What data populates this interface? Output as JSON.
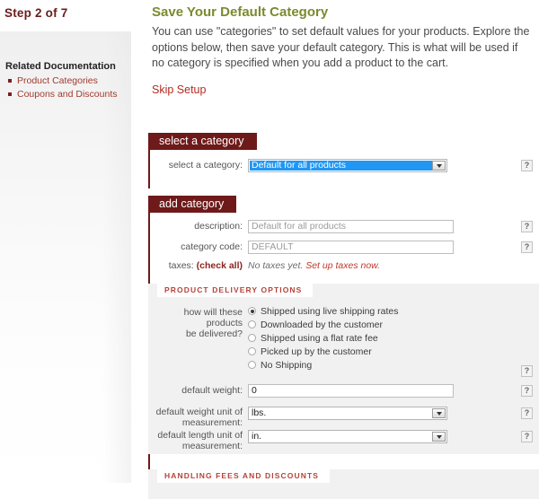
{
  "sidebar": {
    "step_label": "Step 2 of 7",
    "related_title": "Related Documentation",
    "links": [
      {
        "label": "Product Categories"
      },
      {
        "label": "Coupons and Discounts"
      }
    ]
  },
  "main": {
    "title": "Save Your Default Category",
    "intro": "You can use \"categories\" to set default values for your products. Explore the options below, then save your default category. This is what will be used if no category is specified when you add a product to the cart.",
    "skip_link": "Skip Setup"
  },
  "select_category_section": {
    "heading": "select a category",
    "row": {
      "label": "select a category:",
      "value": "Default for all products",
      "help": "?"
    }
  },
  "add_category_section": {
    "heading": "add category",
    "description_row": {
      "label": "description:",
      "value": "Default for all products",
      "help": "?"
    },
    "category_code_row": {
      "label": "category code:",
      "value": "DEFAULT",
      "help": "?"
    },
    "taxes_row": {
      "label": "taxes:",
      "check_all": "(check all)",
      "note": "No taxes yet.",
      "action": "Set up taxes now."
    }
  },
  "delivery_panel": {
    "heading": "PRODUCT DELIVERY OPTIONS",
    "question_label_line1": "how will these products",
    "question_label_line2": "be delivered?",
    "options": [
      {
        "label": "Shipped using live shipping rates",
        "selected": true
      },
      {
        "label": "Downloaded by the customer",
        "selected": false
      },
      {
        "label": "Shipped using a flat rate fee",
        "selected": false
      },
      {
        "label": "Picked up by the customer",
        "selected": false
      },
      {
        "label": "No Shipping",
        "selected": false
      }
    ],
    "delivery_help": "?",
    "default_weight_row": {
      "label": "default weight:",
      "value": "0",
      "help": "?"
    },
    "weight_unit_row": {
      "label_line1": "default weight unit of",
      "label_line2": "measurement:",
      "value": "lbs.",
      "help": "?"
    },
    "length_unit_row": {
      "label_line1": "default length unit of",
      "label_line2": "measurement:",
      "value": "in.",
      "help": "?"
    }
  },
  "handling_panel": {
    "heading": "HANDLING FEES AND DISCOUNTS"
  }
}
